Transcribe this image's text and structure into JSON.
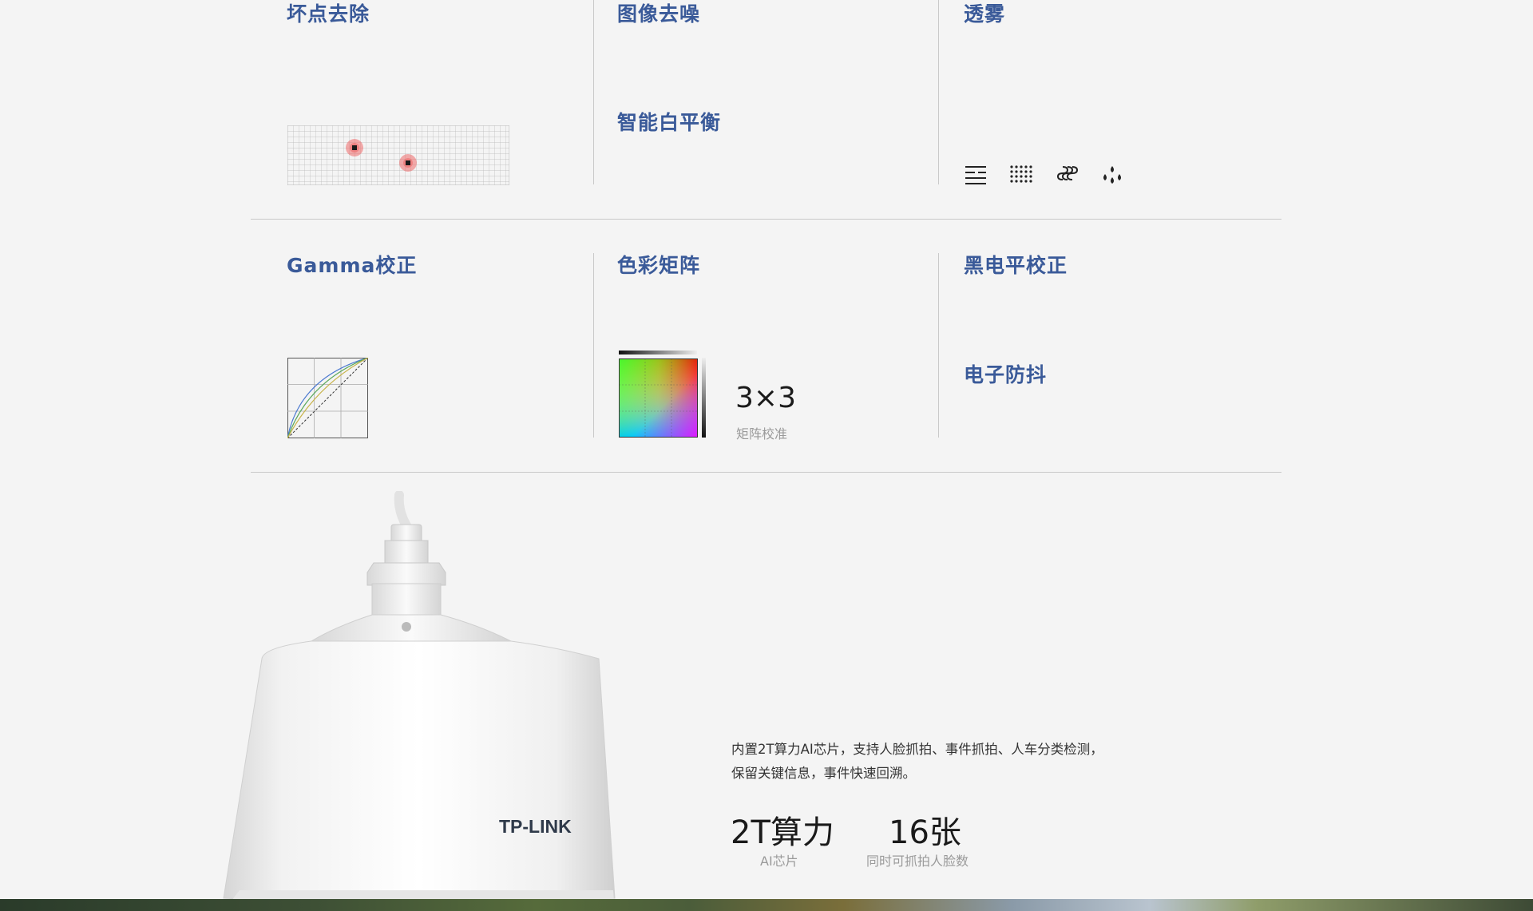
{
  "features": {
    "row1": {
      "col1_title": "坏点去除",
      "col2_title_a": "图像去噪",
      "col2_title_b": "智能白平衡",
      "col3_title": "透雾"
    },
    "row2": {
      "col1_title": "Gamma校正",
      "col2_title": "色彩矩阵",
      "col3_title_a": "黑电平校正",
      "col3_title_b": "电子防抖"
    },
    "matrix": {
      "value": "3×3",
      "caption": "矩阵校准"
    },
    "defog_icons": [
      "layers-icon",
      "dot-grid-icon",
      "waves-icon",
      "droplets-icon"
    ]
  },
  "product": {
    "brand": "TP-LINK",
    "description_line1": "内置2T算力AI芯片，支持人脸抓拍、事件抓拍、人车分类检测，",
    "description_line2": "保留关键信息，事件快速回溯。",
    "stats": [
      {
        "value": "2T算力",
        "caption": "AI芯片"
      },
      {
        "value": "16张",
        "caption": "同时可抓拍人脸数"
      }
    ]
  },
  "colors": {
    "title": "#3a5a99",
    "background": "#f4f4f4",
    "divider": "#c9c9c9"
  }
}
